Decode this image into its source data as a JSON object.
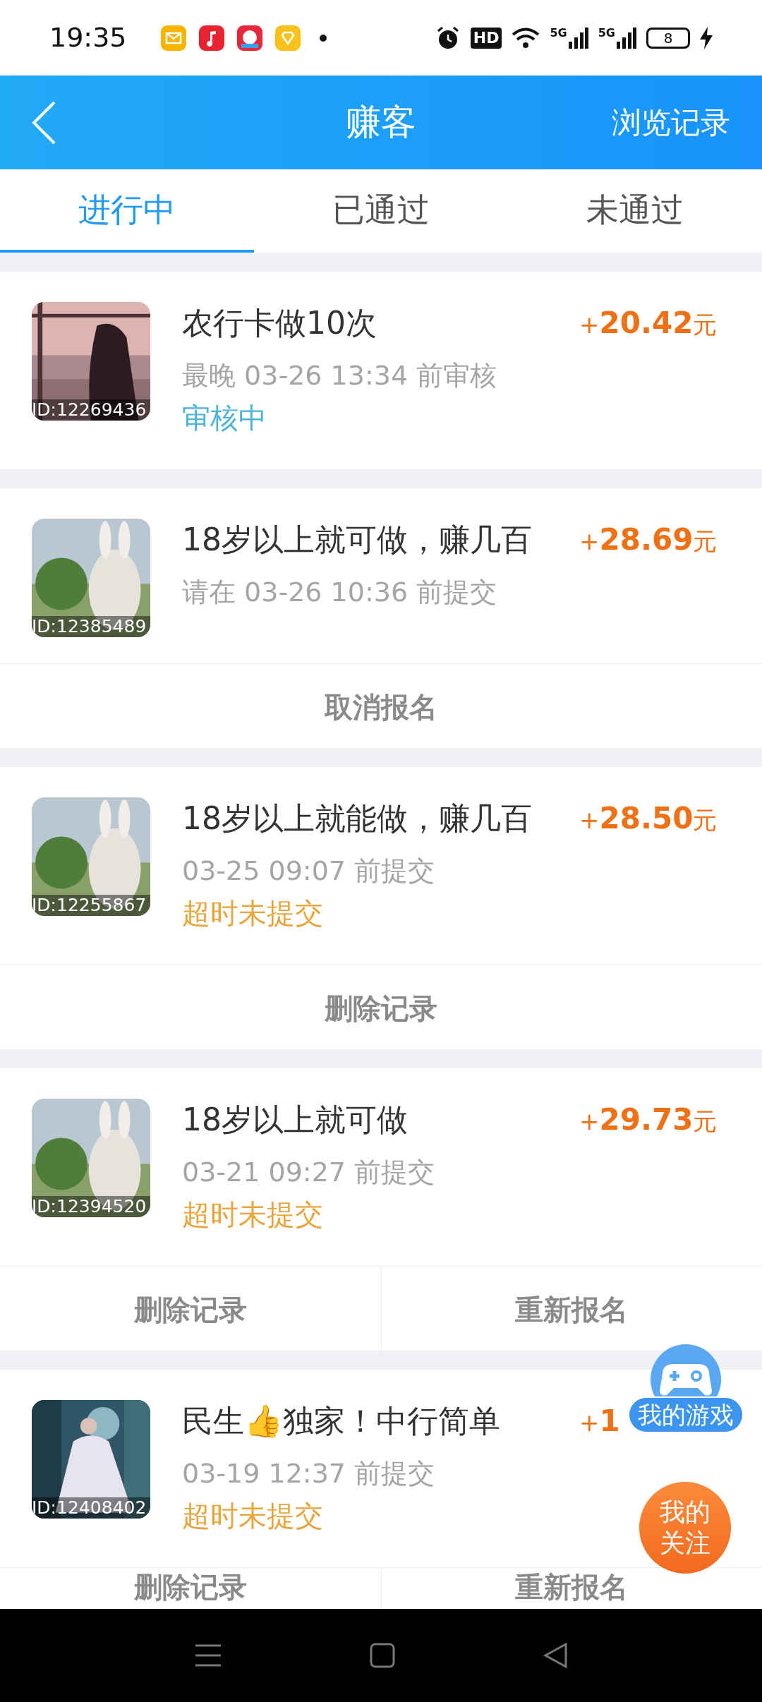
{
  "status_bar": {
    "time": "19:35",
    "hd": "HD",
    "network_labels": [
      "5G",
      "5G"
    ],
    "battery": "8"
  },
  "header": {
    "title": "赚客",
    "action": "浏览记录"
  },
  "tabs": [
    {
      "label": "进行中",
      "selected": true
    },
    {
      "label": "已通过",
      "selected": false
    },
    {
      "label": "未通过",
      "selected": false
    }
  ],
  "tasks": [
    {
      "title": "农行卡做10次",
      "amount": "20.42",
      "sign": "+",
      "unit": "元",
      "deadline": "最晚 03-26 13:34 前审核",
      "status": {
        "kind": "reviewing",
        "text": "审核中"
      },
      "id_label": "ID:12269436"
    },
    {
      "title": "18岁以上就可做，赚几百",
      "amount": "28.69",
      "sign": "+",
      "unit": "元",
      "deadline": "请在 03-26 10:36 前提交",
      "id_label": "ID:12385489",
      "actions": [
        "取消报名"
      ]
    },
    {
      "title": "18岁以上就能做，赚几百",
      "amount": "28.50",
      "sign": "+",
      "unit": "元",
      "deadline": "03-25 09:07 前提交",
      "status": {
        "kind": "timeout",
        "text": "超时未提交"
      },
      "id_label": "ID:12255867",
      "actions": [
        "删除记录"
      ]
    },
    {
      "title": "18岁以上就可做",
      "amount": "29.73",
      "sign": "+",
      "unit": "元",
      "deadline": "03-21 09:27 前提交",
      "status": {
        "kind": "timeout",
        "text": "超时未提交"
      },
      "id_label": "ID:12394520",
      "actions": [
        "删除记录",
        "重新报名"
      ]
    },
    {
      "title": "民生👍独家！中行简单",
      "amount": "1",
      "sign": "+",
      "deadline": "03-19 12:37 前提交",
      "status": {
        "kind": "timeout",
        "text": "超时未提交"
      },
      "id_label": "ID:12408402",
      "actions": [
        "删除记录",
        "重新报名"
      ]
    }
  ],
  "floating": {
    "games": "我的游戏",
    "follow": "我的关注"
  }
}
